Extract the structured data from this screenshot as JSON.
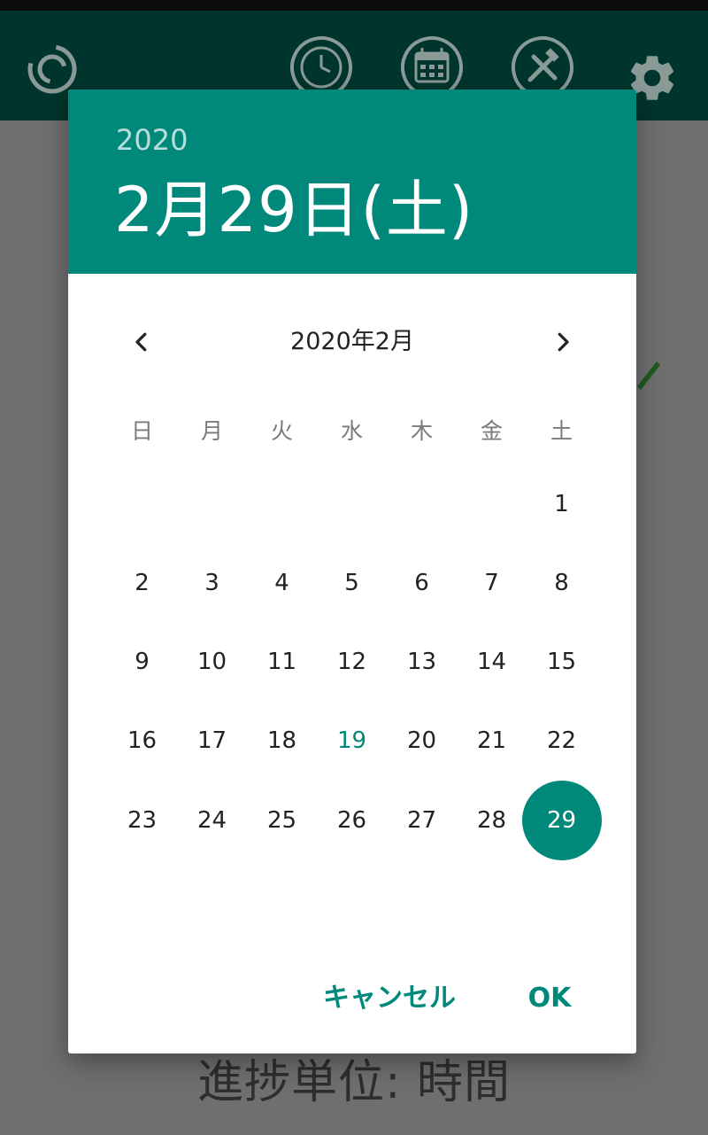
{
  "app_bar": {
    "icons": [
      "progress-ring-icon",
      "clock-icon",
      "calendar-icon",
      "tools-icon",
      "gear-icon"
    ],
    "colors": {
      "background": "#00352d",
      "icon": "#8a9a97"
    }
  },
  "background": {
    "partial_text": "進捗単位: 時間",
    "accent_icon": "pencil-icon"
  },
  "dialog": {
    "year": "2020",
    "selected_date": "2月29日(土)",
    "month_label": "2020年2月",
    "weekdays": [
      "日",
      "月",
      "火",
      "水",
      "木",
      "金",
      "土"
    ],
    "weeks": [
      [
        "",
        "",
        "",
        "",
        "",
        "",
        "1"
      ],
      [
        "2",
        "3",
        "4",
        "5",
        "6",
        "7",
        "8"
      ],
      [
        "9",
        "10",
        "11",
        "12",
        "13",
        "14",
        "15"
      ],
      [
        "16",
        "17",
        "18",
        "19",
        "20",
        "21",
        "22"
      ],
      [
        "23",
        "24",
        "25",
        "26",
        "27",
        "28",
        "29"
      ]
    ],
    "today_day": "19",
    "selected_day": "29",
    "cancel_label": "キャンセル",
    "ok_label": "OK",
    "colors": {
      "accent": "#00897b",
      "header_text": "#ffffff"
    }
  }
}
